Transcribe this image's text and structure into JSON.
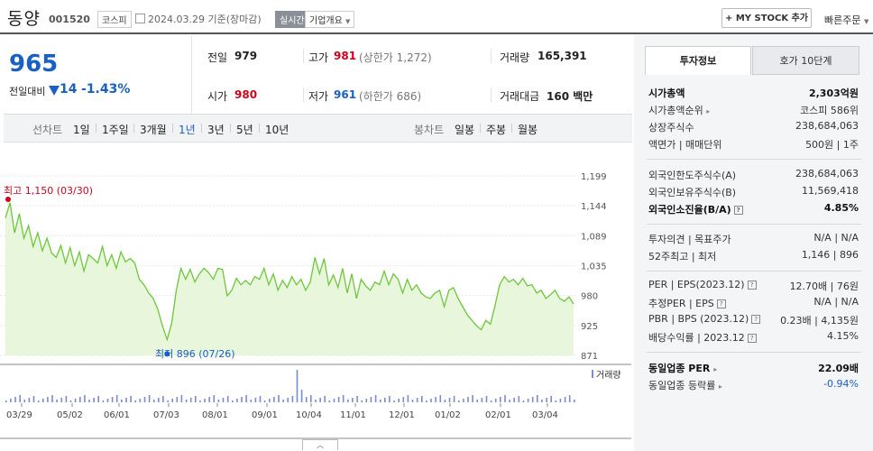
{
  "header": {
    "stock_name": "동양",
    "stock_code": "001520",
    "market": "코스피",
    "date_text": "2024.03.29 기준(장마감)",
    "realtime": "실시간",
    "company_info": "기업개요",
    "my_stock_button": "+ MY STOCK 추가",
    "quick_order": "빠른주문"
  },
  "price": {
    "current": "965",
    "change_label": "전일대비",
    "change_amount": "14",
    "change_percent": "-1.43%",
    "direction": "down",
    "prev_close_label": "전일",
    "prev_close": "979",
    "high_label": "고가",
    "high": "981",
    "upper_limit": "(상한가 1,272)",
    "volume_label": "거래량",
    "volume": "165,391",
    "open_label": "시가",
    "open": "980",
    "low_label": "저가",
    "low": "961",
    "lower_limit": "(하한가 686)",
    "amount_label": "거래대금",
    "amount": "160 백만"
  },
  "period_bar": {
    "line_label": "선차트",
    "line_periods": [
      "1일",
      "1주일",
      "3개월",
      "1년",
      "3년",
      "5년",
      "10년"
    ],
    "active_period": "1년",
    "candle_label": "봉차트",
    "candle_periods": [
      "일봉",
      "주봉",
      "월봉"
    ]
  },
  "chart_data": {
    "type": "area",
    "title": "",
    "y_ticks": [
      "1,199",
      "1,144",
      "1,089",
      "1,035",
      "980",
      "925",
      "871"
    ],
    "ylim": [
      871,
      1199
    ],
    "x_ticks": [
      "03/29",
      "05/02",
      "06/01",
      "07/03",
      "08/01",
      "09/01",
      "10/04",
      "11/01",
      "12/01",
      "01/02",
      "02/01",
      "03/04"
    ],
    "max_label": "최고 1,150 (03/30)",
    "min_label": "최저 896 (07/26)",
    "volume_label": "거래량",
    "line_color": "#6cc73a",
    "fill_color": "#e8f6dc",
    "series": [
      {
        "values": [
          1122,
          1150,
          1095,
          1130,
          1085,
          1108,
          1070,
          1095,
          1062,
          1085,
          1058,
          1050,
          1072,
          1040,
          1068,
          1035,
          1060,
          1025,
          1055,
          1048,
          1040,
          1070,
          1035,
          1055,
          1030,
          1060,
          1042,
          1048,
          1040,
          1010,
          1000,
          985,
          975,
          955,
          925,
          900,
          930,
          990,
          1030,
          1010,
          1028,
          1005,
          1020,
          1030,
          1022,
          1010,
          1030,
          1028,
          980,
          990,
          1012,
          1000,
          1008,
          1000,
          1015,
          1010,
          1030,
          1000,
          1020,
          990,
          1008,
          995,
          1015,
          1000,
          1010,
          990,
          1005,
          1050,
          1020,
          1048,
          1000,
          1018,
          995,
          1030,
          985,
          1020,
          975,
          1010,
          998,
          990,
          1005,
          1000,
          1025,
          1000,
          1020,
          1010,
          985,
          1010,
          990,
          1000,
          985,
          978,
          975,
          985,
          990,
          960,
          990,
          995,
          975,
          960,
          945,
          935,
          925,
          918,
          935,
          928,
          962,
          1000,
          1015,
          1005,
          1010,
          1000,
          1012,
          998,
          1000,
          985,
          990,
          975,
          982,
          990,
          975,
          970,
          978,
          965
        ]
      }
    ]
  },
  "right_panel": {
    "tab_invest": "투자정보",
    "tab_hoga": "호가 10단계",
    "market_cap_label": "시가총액",
    "market_cap": "2,303억원",
    "market_cap_rank_label": "시가총액순위",
    "market_cap_rank": "코스피 586위",
    "shares_label": "상장주식수",
    "shares": "238,684,063",
    "par_label": "액면가 | 매매단위",
    "par": "500원 | 1주",
    "foreign_limit_label": "외국인한도주식수(A)",
    "foreign_limit": "238,684,063",
    "foreign_hold_label": "외국인보유주식수(B)",
    "foreign_hold": "11,569,418",
    "foreign_ratio_label": "외국인소진율(B/A)",
    "foreign_ratio": "4.85%",
    "opinion_label": "투자의견 | 목표주가",
    "opinion": "N/A | N/A",
    "week52_label": "52주최고 | 최저",
    "week52": "1,146 | 896",
    "per_label": "PER | EPS(2023.12)",
    "per": "12.70배 | 76원",
    "est_per_label": "추정PER | EPS",
    "est_per": "N/A | N/A",
    "pbr_label": "PBR | BPS (2023.12)",
    "pbr": "0.23배 | 4,135원",
    "dividend_label": "배당수익률 | 2023.12",
    "dividend": "4.15%",
    "sector_per_label": "동일업종 PER",
    "sector_per": "22.09배",
    "sector_rate_label": "동일업종 등락률",
    "sector_rate": "-0.94%"
  }
}
